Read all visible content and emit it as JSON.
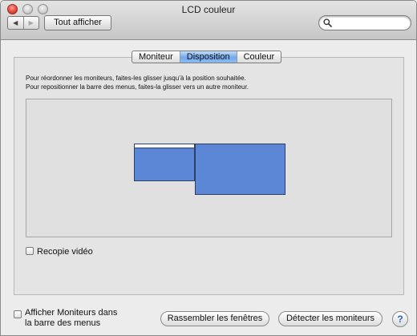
{
  "window": {
    "title": "LCD couleur"
  },
  "toolbar": {
    "back_icon": "back-triangle-icon",
    "forward_icon": "forward-triangle-icon",
    "show_all_label": "Tout afficher",
    "search_placeholder": "",
    "search_icon": "magnifier-icon"
  },
  "tabs": [
    {
      "label": "Moniteur",
      "selected": false
    },
    {
      "label": "Disposition",
      "selected": true
    },
    {
      "label": "Couleur",
      "selected": false
    }
  ],
  "arrangement": {
    "instructions": [
      "Pour réordonner les moniteurs, faites-les glisser jusqu’à la position souhaitée.",
      "Pour repositionner la barre des menus, faites-la glisser vers un autre moniteur."
    ],
    "monitor_color": "#5c87d7",
    "mirror_label": "Recopie vidéo",
    "mirror_checked": false
  },
  "footer": {
    "menubar_label_line1": "Afficher Moniteurs dans",
    "menubar_label_line2": "la barre des menus",
    "menubar_checked": false,
    "gather_button": "Rassembler les fenêtres",
    "detect_button": "Détecter les moniteurs",
    "help_label": "?"
  },
  "colors": {
    "accent_tab": "#6fa8ee",
    "help_glyph": "#2b62c4"
  }
}
